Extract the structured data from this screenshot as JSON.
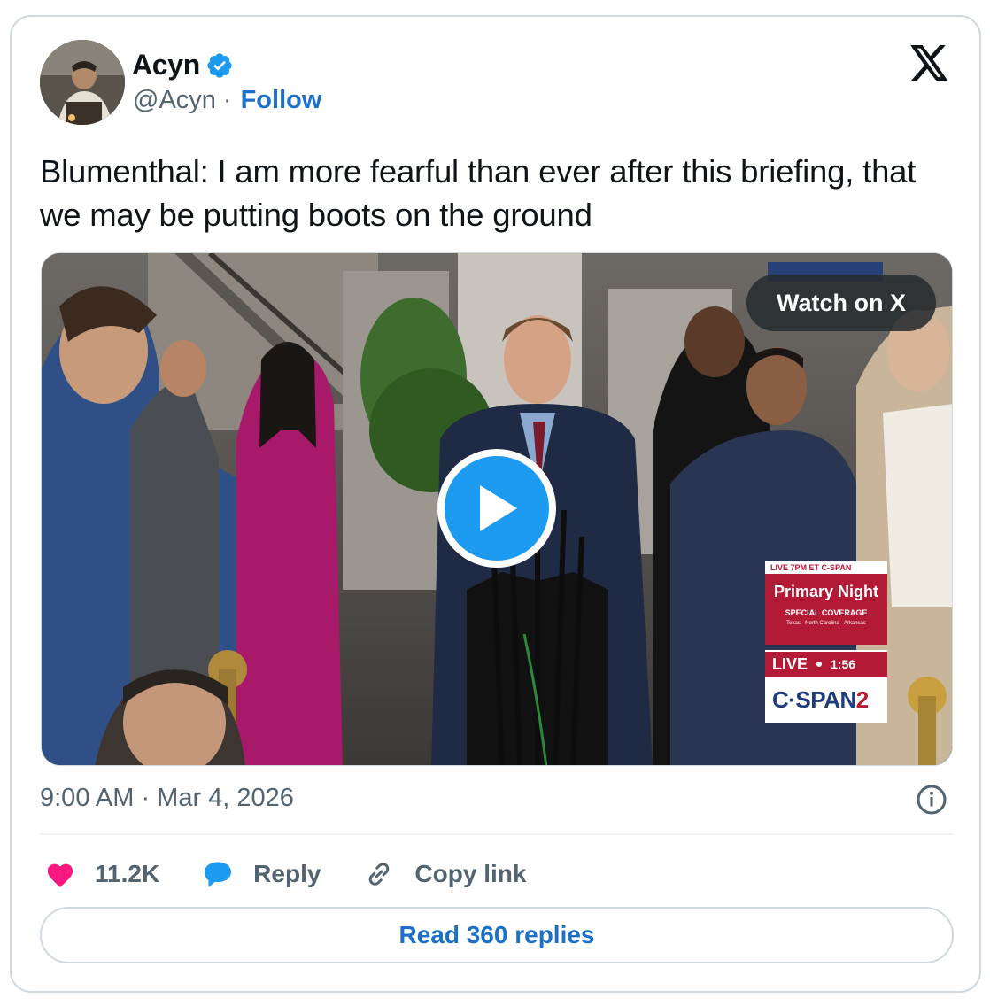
{
  "author": {
    "name": "Acyn",
    "handle": "@Acyn",
    "separator": "·",
    "follow_label": "Follow"
  },
  "tweet": {
    "text": "Blumenthal: I am more fearful than ever after this briefing, that we may be putting boots on the ground"
  },
  "media": {
    "watch_label": "Watch on X",
    "overlay": {
      "top": "LIVE 7PM ET C-SPAN",
      "title": "Primary Night",
      "subtitle": "SPECIAL COVERAGE",
      "states": "Texas · North Carolina · Arkansas",
      "live": "LIVE",
      "time": "1:56",
      "logo_main": "C·SPAN",
      "logo_num": "2"
    }
  },
  "timestamp": "9:00 AM · Mar 4, 2026",
  "actions": {
    "likes": "11.2K",
    "reply": "Reply",
    "copy_link": "Copy link"
  },
  "read_replies": "Read 360 replies",
  "colors": {
    "like": "#f91880",
    "reply_icon": "#1d9bf0",
    "link": "#1d70c8",
    "verified": "#1d9bf0"
  },
  "icons": [
    "verified-badge-icon",
    "x-logo-icon",
    "play-icon",
    "info-icon",
    "heart-icon",
    "reply-bubble-icon",
    "link-icon"
  ]
}
